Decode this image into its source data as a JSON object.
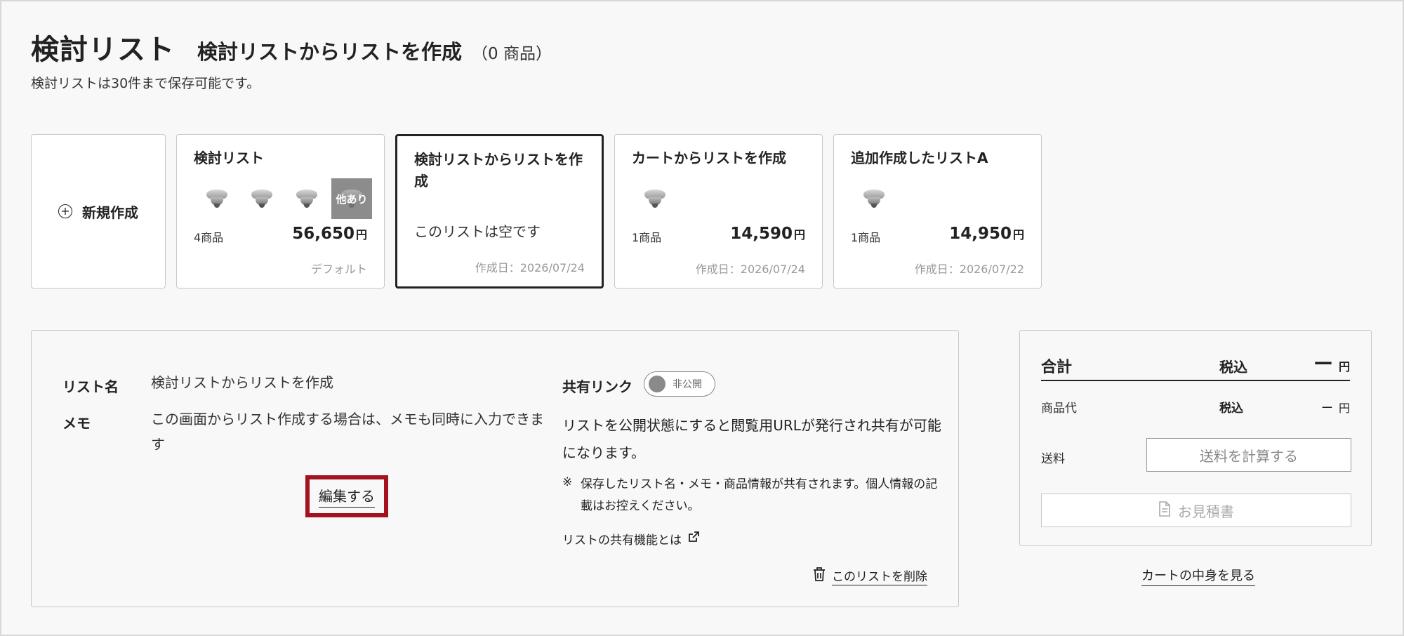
{
  "header": {
    "page_title": "検討リスト",
    "list_title": "検討リストからリストを作成",
    "item_count": "（0 商品）",
    "subtitle": "検討リストは30件まで保存可能です。"
  },
  "cards": {
    "new_label": "新規作成",
    "items": [
      {
        "name": "検討リスト",
        "count": "4商品",
        "price": "56,650",
        "yen": "円",
        "footer": "デフォルト",
        "more_label": "他あり"
      },
      {
        "name": "検討リストからリストを作成",
        "empty_text": "このリストは空です",
        "footer": "作成日：2026/07/24"
      },
      {
        "name": "カートからリストを作成",
        "count": "1商品",
        "price": "14,590",
        "yen": "円",
        "footer": "作成日：2026/07/24"
      },
      {
        "name": "追加作成したリストA",
        "count": "1商品",
        "price": "14,950",
        "yen": "円",
        "footer": "作成日：2026/07/22"
      }
    ]
  },
  "details": {
    "list_name_label": "リスト名",
    "list_name_value": "検討リストからリストを作成",
    "memo_label": "メモ",
    "memo_value": "この画面からリスト作成する場合は、メモも同時に入力できます",
    "edit_label": "編集する",
    "share_label": "共有リンク",
    "toggle_state": "非公開",
    "share_desc": "リストを公開状態にすると閲覧用URLが発行され共有が可能になります。",
    "note_mark": "※",
    "note_text": "保存したリスト名・メモ・商品情報が共有されます。個人情報の記載はお控えください。",
    "share_help": "リストの共有機能とは",
    "delete_label": "このリストを削除"
  },
  "summary": {
    "total_label": "合計",
    "tax_label": "税込",
    "total_value": "ー",
    "yen": "円",
    "product_label": "商品代",
    "product_tax": "税込",
    "product_value": "ー",
    "shipping_label": "送料",
    "calc_button": "送料を計算する",
    "quote_button": "お見積書",
    "cart_link": "カートの中身を見る"
  },
  "colors": {
    "highlight": "#a3121e",
    "selected_border": "#222222",
    "more_thumb_bg": "#8c8c8c"
  }
}
